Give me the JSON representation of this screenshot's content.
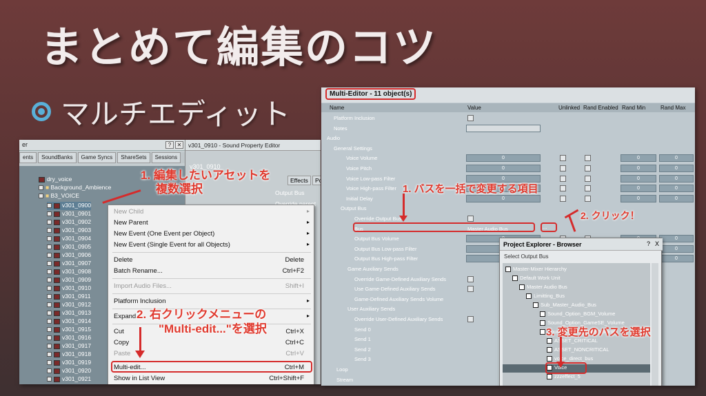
{
  "slide": {
    "title": "まとめて編集のコツ",
    "subtitle": "マルチエディット"
  },
  "left": {
    "panel_title": "er",
    "tabs": [
      "ents",
      "SoundBanks",
      "Game Syncs",
      "ShareSets",
      "Sessions"
    ],
    "tree": {
      "root": "dry_voice",
      "background": "Background_Ambience",
      "folder": "B3_VOICE",
      "items": [
        "v301_0900",
        "v301_0901",
        "v301_0902",
        "v301_0903",
        "v301_0904",
        "v301_0905",
        "v301_0906",
        "v301_0907",
        "v301_0908",
        "v301_0909",
        "v301_0910",
        "v301_0911",
        "v301_0912",
        "v301_0913",
        "v301_0914",
        "v301_0915",
        "v301_0916",
        "v301_0917",
        "v301_0918",
        "v301_0919",
        "v301_0920",
        "v301_0921",
        "v301_0922"
      ]
    },
    "spe": {
      "title": "v301_0910 - Sound Property Editor",
      "name": "v301_0910",
      "tab_effects": "Effects",
      "tab_pos": "Po",
      "output_bus": "Output Bus",
      "override_parent": "Override parent"
    },
    "menu": {
      "new_child": "New Child",
      "new_parent": "New Parent",
      "new_event_one": "New Event (One Event per Object)",
      "new_event_single": "New Event (Single Event for all Objects)",
      "delete": "Delete",
      "delete_key": "Delete",
      "batch_rename": "Batch Rename...",
      "batch_rename_key": "Ctrl+F2",
      "import_audio": "Import Audio Files...",
      "import_audio_key": "Shift+I",
      "platform_inclusion": "Platform Inclusion",
      "expand": "Expand",
      "cut": "Cut",
      "cut_key": "Ctrl+X",
      "copy": "Copy",
      "copy_key": "Ctrl+C",
      "paste": "Paste",
      "paste_key": "Ctrl+V",
      "multi_edit": "Multi-edit...",
      "multi_edit_key": "Ctrl+M",
      "show_in_list": "Show in List View",
      "show_in_list_key": "Ctrl+Shift+F"
    },
    "annotations": {
      "step1_line1": "1. 編集したいアセットを",
      "step1_line2": "複数選択",
      "step2_line1": "2. 右クリックメニューの",
      "step2_line2": "\"Multi-edit...\"を選択"
    }
  },
  "right": {
    "title": "Multi-Editor - 11 object(s)",
    "columns": [
      "Name",
      "Value",
      "Unlinked",
      "Rand Enabled",
      "Rand Min",
      "Rand Max"
    ],
    "rows": {
      "platform_inclusion": "Platform Inclusion",
      "notes": "Notes",
      "audio": "Audio",
      "general_settings": "General Settings",
      "voice_volume": "Voice Volume",
      "voice_pitch": "Voice Pitch",
      "voice_lpf": "Voice Low-pass Filter",
      "voice_hpf": "Voice High-pass Filter",
      "initial_delay": "Initial Delay",
      "output_bus": "Output Bus",
      "override_output_bus": "Override Output Bus",
      "bus": "Bus",
      "bus_value": "Master Audio Bus",
      "output_bus_volume": "Output Bus Volume",
      "output_bus_lpf": "Output Bus Low-pass Filter",
      "output_bus_hpf": "Output Bus High-pass Filter",
      "game_aux_sends": "Game Auxiliary Sends",
      "override_game_aux": "Override Game-Defined Auxiliary Sends",
      "use_game_aux": "Use Game-Defined Auxiliary Sends",
      "game_aux_volume": "Game-Defined Auxiliary Sends Volume",
      "user_aux_sends": "User Auxiliary Sends",
      "override_user_aux": "Override User-Defined Auxiliary Sends",
      "send0": "Send 0",
      "send1": "Send 1",
      "send2": "Send 2",
      "send3": "Send 3",
      "loop": "Loop",
      "stream": "Stream"
    },
    "zero": "0",
    "browse_dots": "...",
    "explorer": {
      "title": "Project Explorer - Browser",
      "help": "?",
      "close": "X",
      "label": "Select Output Bus",
      "nodes": {
        "hierarchy": "Master-Mixer Hierarchy",
        "work_unit": "Default Work Unit",
        "master_bus": "Master Audio Bus",
        "limiting_bus": "Limitting_Bus",
        "sub_master": "Sub_Master_Audio_Bus",
        "bgm": "Sound_Option_BGM_Volume",
        "gamese": "Sound_Option_GameSE_Volume",
        "voice_vol": "Sound_Option_Voice_Volume",
        "critical": "ASSET_CRITICAL",
        "noncritical": "ASSET_NONCRITICAL",
        "direct": "voice_direct_bus",
        "voice": "Voice",
        "zzz": "zzzeffect_5"
      }
    },
    "annotations": {
      "step1": "1. バスを一括で変更する項目",
      "step2": "2. クリック！",
      "step3": "3. 変更先のバスを選択"
    }
  }
}
